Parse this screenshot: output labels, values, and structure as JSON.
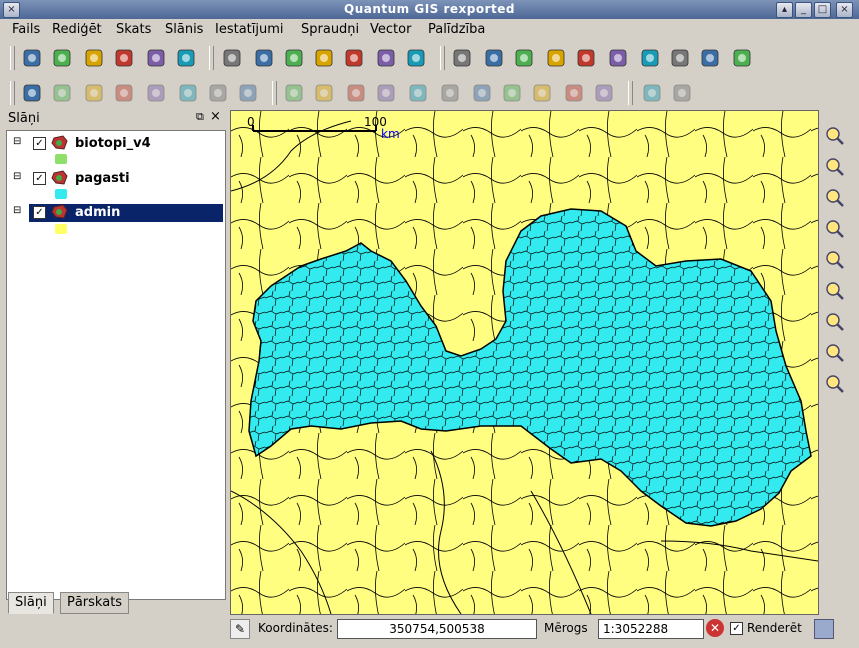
{
  "window": {
    "title": "Quantum GIS rexported"
  },
  "menu": [
    "Fails",
    "Rediģēt",
    "Skats",
    "Slānis",
    "Iestatījumi",
    "Spraudņi",
    "Vector",
    "Palīdzība"
  ],
  "toolbar1_icons": [
    "new-project-icon",
    "open-project-icon",
    "save-project-icon",
    "save-as-icon",
    "print-composer-icon",
    "print-icon",
    "add-vector-layer-icon",
    "add-raster-layer-icon",
    "add-postgis-layer-icon",
    "add-spatialite-layer-icon",
    "add-wms-layer-icon",
    "new-vector-layer-icon",
    "remove-layer-icon",
    "identify-icon",
    "select-icon",
    "deselect-icon",
    "attribute-table-icon",
    "measure-icon",
    "map-tips-icon",
    "spatial-bookmark-icon",
    "new-bookmark-icon",
    "label-icon",
    "annotation-icon"
  ],
  "toolbar2_icons": [
    "toggle-editing-icon",
    "save-edits-icon",
    "capture-point-icon",
    "move-feature-icon",
    "delete-selected-icon",
    "cut-features-icon",
    "copy-features-icon",
    "paste-features-icon",
    "undo-icon",
    "redo-icon",
    "simplify-feature-icon",
    "add-ring-icon",
    "add-island-icon",
    "delete-ring-icon",
    "delete-part-icon",
    "reshape-features-icon",
    "split-features-icon",
    "merge-features-icon",
    "rotate-point-symbols-icon",
    "measure-line-icon",
    "zoom-magnifier-icon"
  ],
  "legend": {
    "title": "Slāņi",
    "layers": [
      {
        "name": "biotopi_v4",
        "checked": true,
        "selected": false,
        "swatch": "#8fe06a"
      },
      {
        "name": "pagasti",
        "checked": true,
        "selected": false,
        "swatch": "#33ebef"
      },
      {
        "name": "admin",
        "checked": true,
        "selected": true,
        "swatch": "#ffff66"
      }
    ],
    "tabs": [
      "Slāņi",
      "Pārskats"
    ]
  },
  "map": {
    "scalebar_labels": [
      "0",
      "100",
      "km"
    ],
    "background": "#fffe80",
    "fill": "#33ebef"
  },
  "map_tools": [
    "pan-icon",
    "zoom-in-icon",
    "zoom-out-icon",
    "zoom-full-icon",
    "zoom-selection-icon",
    "zoom-layer-icon",
    "zoom-last-icon",
    "zoom-next-icon",
    "refresh-icon"
  ],
  "status": {
    "coords_label": "Koordinātes:",
    "coords_value": "350754,500538",
    "scale_label": "Mērogs",
    "scale_value": "1:3052288",
    "render_label": "Renderēt",
    "render_checked": true
  }
}
